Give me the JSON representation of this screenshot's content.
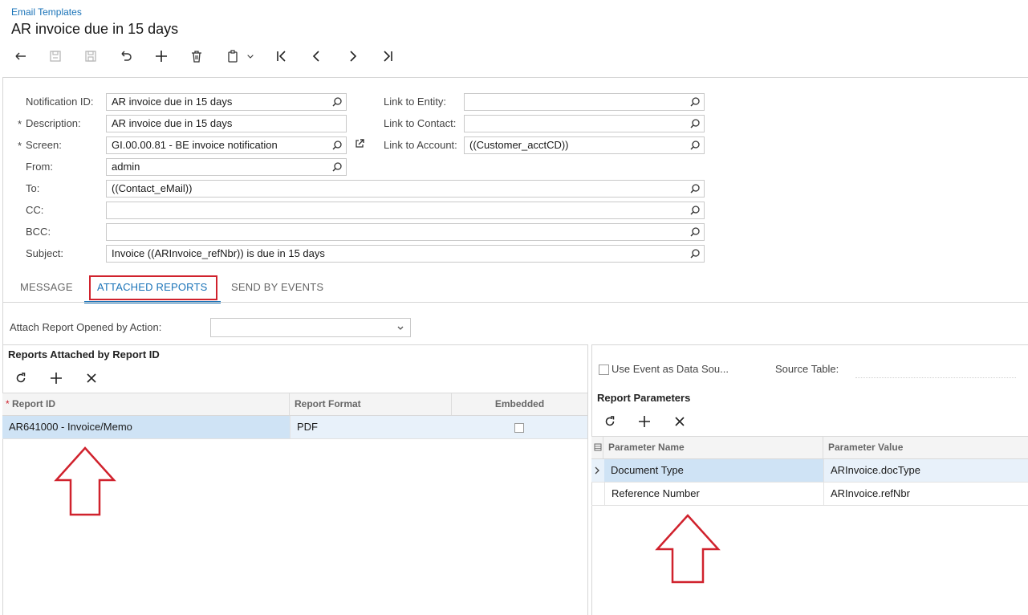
{
  "breadcrumb": "Email Templates",
  "title": "AR invoice due in 15 days",
  "toolbar": {
    "icons": [
      "back-icon",
      "save-icon",
      "save-close-icon",
      "undo-icon",
      "add-icon",
      "delete-icon",
      "copy-paste-icon",
      "first-icon",
      "prev-icon",
      "next-icon",
      "last-icon"
    ]
  },
  "form": {
    "notification_id_label": "Notification ID:",
    "notification_id": "AR invoice due in 15 days",
    "description_label": "Description:",
    "description": "AR invoice due in 15 days",
    "screen_label": "Screen:",
    "screen": "GI.00.00.81 - BE invoice notification",
    "from_label": "From:",
    "from": "admin",
    "to_label": "To:",
    "to": "((Contact_eMail))",
    "cc_label": "CC:",
    "cc": "",
    "bcc_label": "BCC:",
    "bcc": "",
    "subject_label": "Subject:",
    "subject": "Invoice ((ARInvoice_refNbr)) is due in 15 days",
    "link_entity_label": "Link to Entity:",
    "link_entity": "",
    "link_contact_label": "Link to Contact:",
    "link_contact": "",
    "link_account_label": "Link to Account:",
    "link_account": "((Customer_acctCD))",
    "required_mark": "*"
  },
  "tabs": {
    "message": "MESSAGE",
    "attached_reports": "ATTACHED REPORTS",
    "send_by_events": "SEND BY EVENTS",
    "active": "attached_reports"
  },
  "attach": {
    "label": "Attach Report Opened by Action:",
    "value": ""
  },
  "reports": {
    "title": "Reports Attached by Report ID",
    "columns": [
      "Report ID",
      "Report Format",
      "Embedded"
    ],
    "rows": [
      {
        "report_id": "AR641000 - Invoice/Memo",
        "format": "PDF",
        "embedded": false
      }
    ]
  },
  "params": {
    "use_event_label": "Use Event as Data Sou...",
    "use_event_checked": false,
    "source_table_label": "Source Table:",
    "source_table": "",
    "title": "Report Parameters",
    "columns": [
      "Parameter Name",
      "Parameter Value"
    ],
    "rows": [
      {
        "name": "Document Type",
        "value": "ARInvoice.docType"
      },
      {
        "name": "Reference Number",
        "value": "ARInvoice.refNbr"
      }
    ]
  },
  "colors": {
    "accent": "#1a73b8",
    "highlight": "#d0222d",
    "selected_row": "#e8f1fa",
    "selected_cell": "#cfe3f5"
  }
}
